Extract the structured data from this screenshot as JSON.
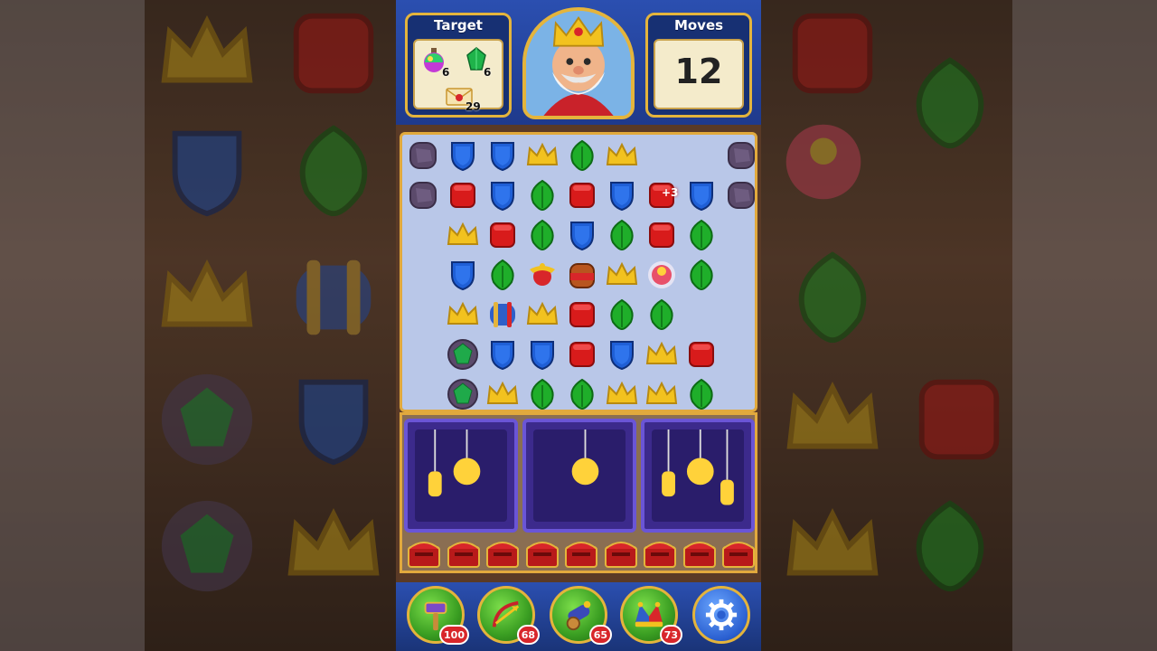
{
  "header": {
    "target_label": "Target",
    "moves_label": "Moves",
    "moves_value": "12",
    "goals": [
      {
        "icon": "potion-icon",
        "count": "6"
      },
      {
        "icon": "emerald-icon",
        "count": "6"
      },
      {
        "icon": "letter-icon",
        "count": "29"
      }
    ]
  },
  "board": {
    "cols": 9,
    "rows": 7,
    "legend": {
      "S": "stone-block",
      "B": "blue-shield",
      "R": "red-box",
      "C": "gold-crown",
      "L": "green-leaf",
      "E": "emerald-in-stone",
      "Y": "yarn-roll",
      "P": "propeller",
      "T": "tnt-barrel",
      "K": "light-ball",
      "_": "empty"
    },
    "grid": [
      [
        "S",
        "B",
        "B",
        "C",
        "L",
        "C",
        "_",
        "_",
        "S"
      ],
      [
        "S",
        "R",
        "B",
        "L",
        "R",
        "B",
        "R",
        "B",
        "S"
      ],
      [
        "_",
        "C",
        "R",
        "L",
        "B",
        "L",
        "R",
        "L",
        "_"
      ],
      [
        "_",
        "B",
        "L",
        "P",
        "T",
        "C",
        "K",
        "L",
        "_"
      ],
      [
        "_",
        "C",
        "Y",
        "C",
        "R",
        "L",
        "L",
        "_",
        "_"
      ],
      [
        "_",
        "E",
        "B",
        "B",
        "R",
        "B",
        "C",
        "R",
        "_"
      ],
      [
        "_",
        "E",
        "C",
        "L",
        "L",
        "C",
        "C",
        "L",
        "_"
      ]
    ],
    "bonus_label": "+3"
  },
  "boosters": [
    {
      "name": "hammer",
      "icon": "hammer-icon",
      "count": "100"
    },
    {
      "name": "arrow",
      "icon": "arrow-icon",
      "count": "68"
    },
    {
      "name": "cannon",
      "icon": "cannon-icon",
      "count": "65"
    },
    {
      "name": "jester",
      "icon": "jester-hat-icon",
      "count": "73"
    },
    {
      "name": "settings",
      "icon": "gear-icon",
      "count": ""
    }
  ],
  "colors": {
    "header_blue": "#2b4fb0",
    "gold_border": "#e4b43c",
    "board_bg": "#b9c7e8",
    "purple_box": "#3c2a8c"
  }
}
